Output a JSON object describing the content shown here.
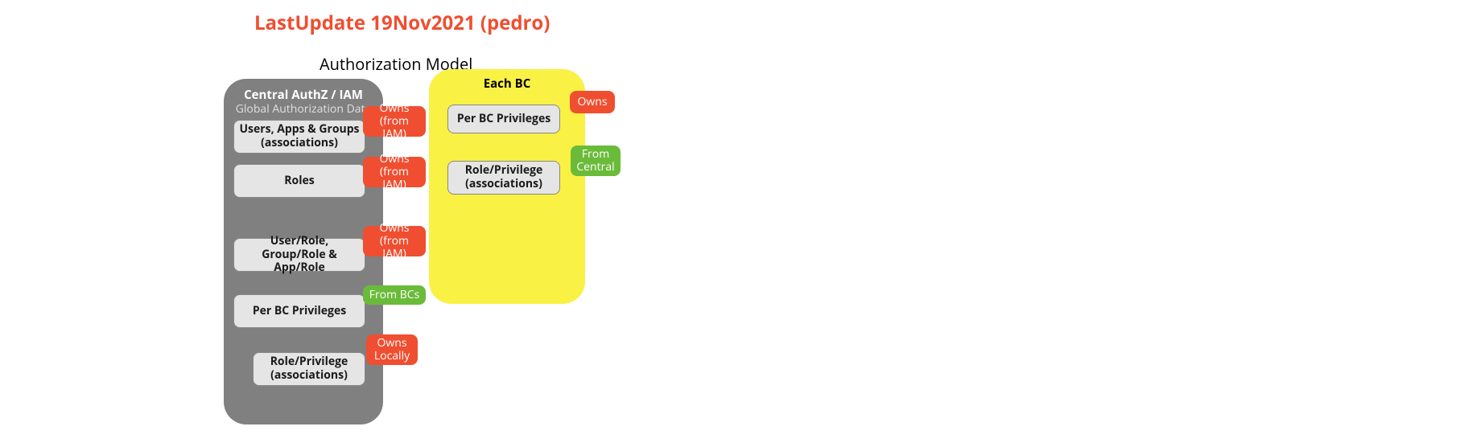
{
  "page": {
    "title": "LastUpdate 19Nov2021 (pedro)",
    "diagram_title": "Authorization Model"
  },
  "central": {
    "title": "Central AuthZ / IAM",
    "subtitle": "Global Authorization Data",
    "items": [
      {
        "label": "Users, Apps & Groups\n(associations)",
        "tag": "Owns\n(from IAM)",
        "tag_kind": "red"
      },
      {
        "label": "Roles",
        "tag": "Owns\n(from IAM)",
        "tag_kind": "red"
      },
      {
        "label": "User/Role, Group/Role\n& App/Role",
        "tag": "Owns\n(from IAM)",
        "tag_kind": "red"
      },
      {
        "label": "Per BC Privileges",
        "tag": "From BCs",
        "tag_kind": "green"
      },
      {
        "label": "Role/Privilege\n(associations)",
        "tag": "Owns\nLocally",
        "tag_kind": "red"
      }
    ]
  },
  "bc": {
    "title": "Each BC",
    "items": [
      {
        "label": "Per BC Privileges",
        "tag": "Owns",
        "tag_kind": "red"
      },
      {
        "label": "Role/Privilege\n(associations)",
        "tag": "From\nCentral",
        "tag_kind": "green"
      }
    ]
  },
  "colors": {
    "accent": "#f04e30",
    "green": "#6bbb3a",
    "grey_box": "#808080",
    "yellow": "#f9f143",
    "item_bg": "#e5e5e5"
  }
}
